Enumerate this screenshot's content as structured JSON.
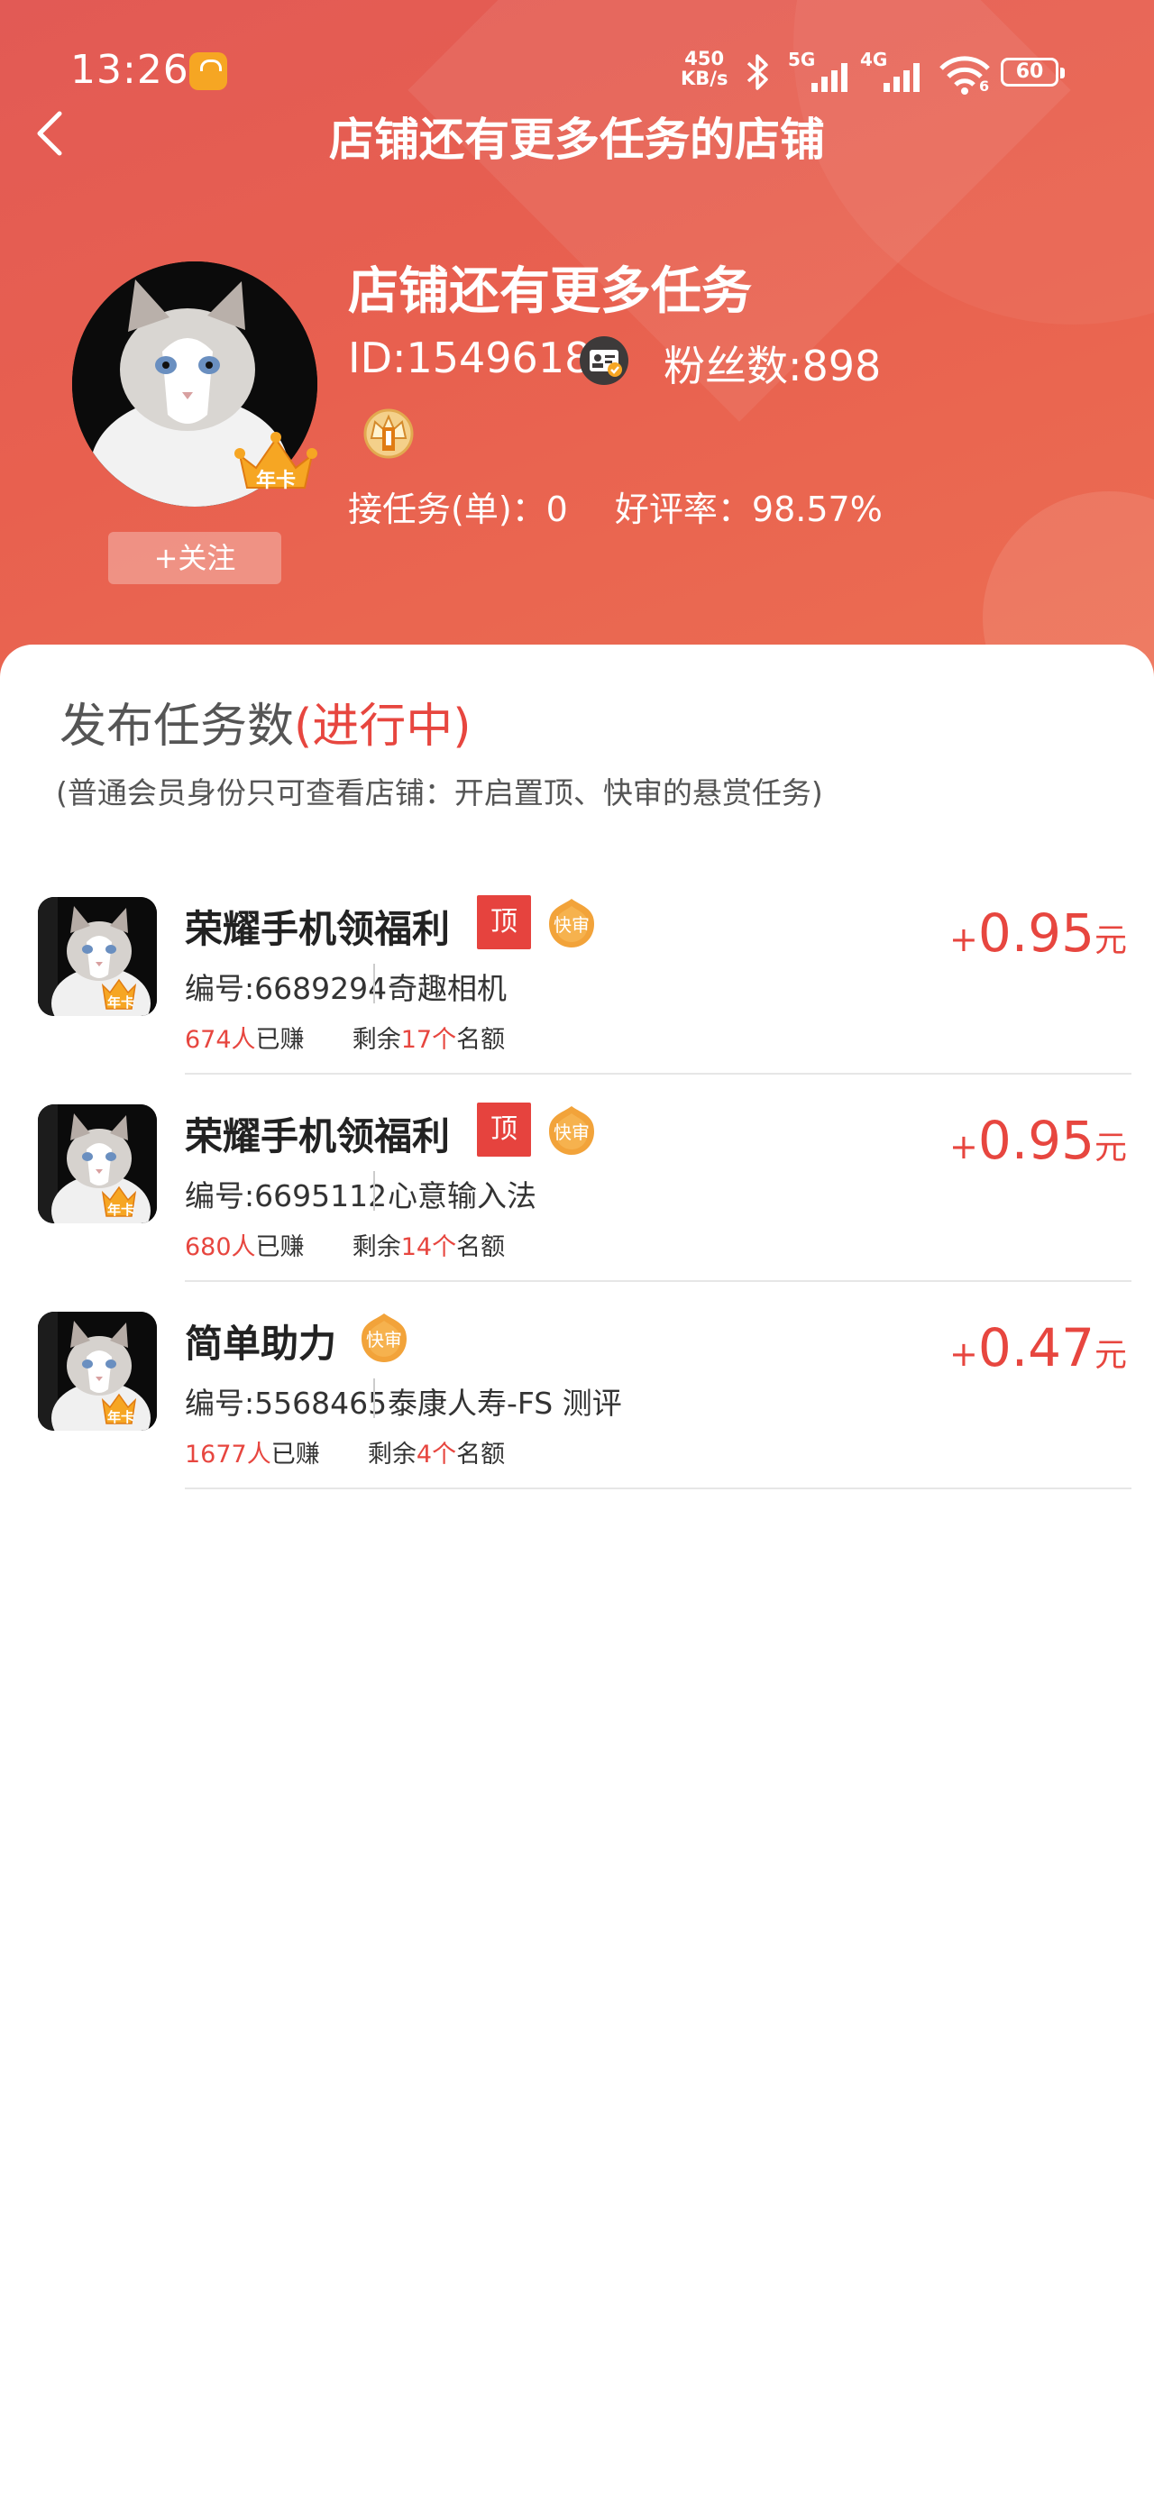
{
  "status_bar": {
    "time": "13:26",
    "net_speed_value": "450",
    "net_speed_unit": "KB/s",
    "net1": "5G",
    "net2": "4G",
    "wifi_sub": "6",
    "battery": "60",
    "icons": [
      "app-notification-icon",
      "bluetooth-icon",
      "signal-icon",
      "wifi-icon",
      "battery-icon"
    ]
  },
  "nav": {
    "back_icon": "chevron-left-icon",
    "title": "店铺还有更多任务的店铺"
  },
  "shop": {
    "name": "店铺还有更多任务",
    "id": "ID:1549618",
    "fans": "粉丝数:898",
    "avatar_badge": "年卡",
    "tasks_taken": "接任务(单)：0",
    "good_rate": "好评率：98.57%",
    "follow_label": "+关注"
  },
  "section": {
    "title": "发布任务数",
    "title_highlight": "(进行中)",
    "note": "(普通会员身份只可查看店铺：开启置顶、快审的悬赏任务)"
  },
  "tag_labels": {
    "top": "顶",
    "fast": "快审"
  },
  "tasks": [
    {
      "title": "荣耀手机领福利",
      "has_top": true,
      "has_fast": true,
      "code": "编号:6689294",
      "app": "奇趣相机",
      "earned_count": "674",
      "earned_unit": "人",
      "earned_suffix": "已赚",
      "remain_prefix": "剩余",
      "remain_count": "17",
      "remain_unit": "个",
      "remain_suffix": "名额",
      "price_sign": "+",
      "price": "0.95",
      "price_unit": "元",
      "badge": "年卡"
    },
    {
      "title": "荣耀手机领福利",
      "has_top": true,
      "has_fast": true,
      "code": "编号:6695112",
      "app": "心意输入法",
      "earned_count": "680",
      "earned_unit": "人",
      "earned_suffix": "已赚",
      "remain_prefix": "剩余",
      "remain_count": "14",
      "remain_unit": "个",
      "remain_suffix": "名额",
      "price_sign": "+",
      "price": "0.95",
      "price_unit": "元",
      "badge": "年卡"
    },
    {
      "title": "简单助力",
      "has_top": false,
      "has_fast": true,
      "code": "编号:5568465",
      "app": "泰康人寿-FS 测评",
      "earned_count": "1677",
      "earned_unit": "人",
      "earned_suffix": "已赚",
      "remain_prefix": "剩余",
      "remain_count": "4",
      "remain_unit": "个",
      "remain_suffix": "名额",
      "price_sign": "+",
      "price": "0.47",
      "price_unit": "元",
      "badge": "年卡"
    }
  ],
  "colors": {
    "header_red": "#e25a55",
    "accent_red": "#e7463f",
    "fast_tag": "#f2a33a",
    "text_dark": "#222222"
  }
}
